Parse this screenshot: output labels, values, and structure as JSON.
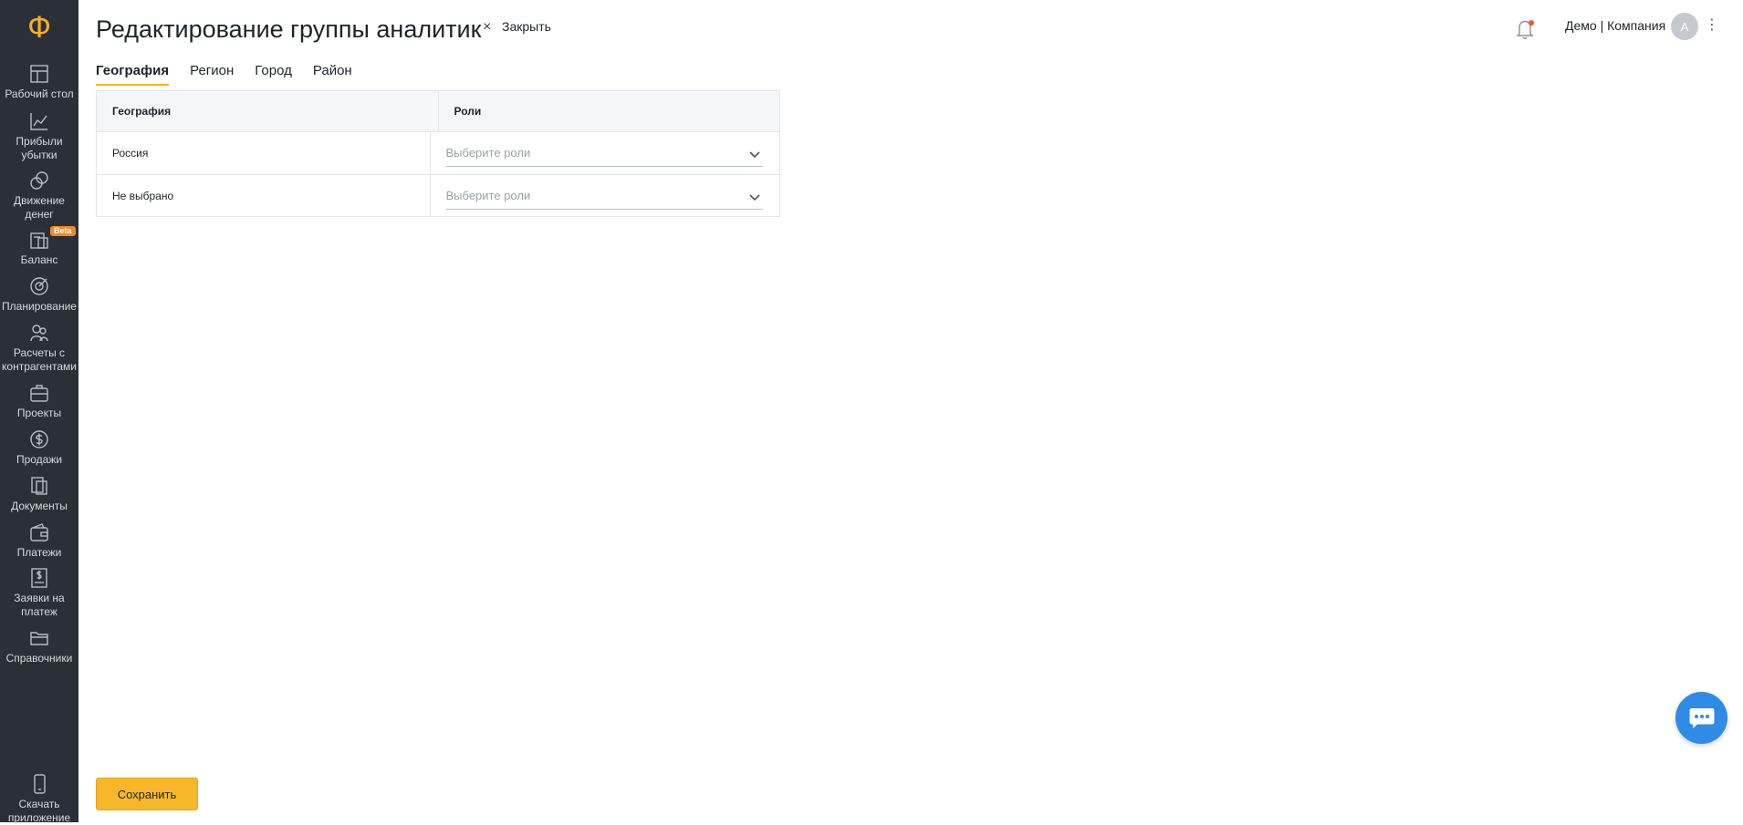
{
  "logo": {
    "glyph": "Ф",
    "color": "#f5b21b"
  },
  "sidebar": {
    "items": [
      {
        "label": "Рабочий стол",
        "icon": "desktop-icon"
      },
      {
        "label": "Прибыли\nубытки",
        "icon": "chart-icon"
      },
      {
        "label": "Движение\nденег",
        "icon": "coins-icon"
      },
      {
        "label": "Баланс",
        "icon": "balance-icon",
        "badge": "Beta"
      },
      {
        "label": "Планирование",
        "icon": "target-icon"
      },
      {
        "label": "Расчеты с\nконтрагентами",
        "icon": "handshake-icon"
      },
      {
        "label": "Проекты",
        "icon": "briefcase-icon"
      },
      {
        "label": "Продажи",
        "icon": "dollar-icon"
      },
      {
        "label": "Документы",
        "icon": "documents-icon"
      },
      {
        "label": "Платежи",
        "icon": "wallet-icon"
      },
      {
        "label": "Заявки на\nплатеж",
        "icon": "invoice-icon"
      },
      {
        "label": "Справочники",
        "icon": "folder-icon"
      }
    ],
    "download": {
      "label": "Скачать\nприложение",
      "icon": "phone-icon"
    }
  },
  "header": {
    "title": "Редактирование группы аналитик",
    "close_x": "×",
    "close_label": "Закрыть",
    "company": "Демо | Компания",
    "avatar_initial": "А",
    "kebab": "⋮"
  },
  "tabs": [
    {
      "label": "География",
      "active": true
    },
    {
      "label": "Регион",
      "active": false
    },
    {
      "label": "Город",
      "active": false
    },
    {
      "label": "Район",
      "active": false
    }
  ],
  "table": {
    "columns": [
      "География",
      "Роли"
    ],
    "rows": [
      {
        "name": "Россия",
        "roles_placeholder": "Выберите роли"
      },
      {
        "name": "Не выбрано",
        "roles_placeholder": "Выберите роли"
      }
    ]
  },
  "footer": {
    "save_label": "Сохранить"
  },
  "colors": {
    "accent": "#f5b21b",
    "sidebar_bg": "#2b2f38",
    "chat": "#2f8be6",
    "notification_dot": "#f05a28"
  }
}
